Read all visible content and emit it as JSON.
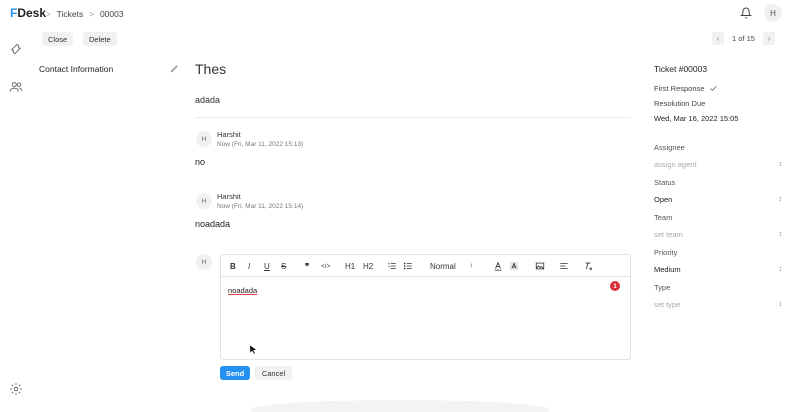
{
  "app": {
    "logo_letter": "F",
    "logo_rest": "Desk"
  },
  "breadcrumb": [
    "Tickets",
    "00003"
  ],
  "user": {
    "initial": "H"
  },
  "toolbar": {
    "close_label": "Close",
    "delete_label": "Delete",
    "pager_text": "1 of 15"
  },
  "contact": {
    "title": "Contact Information"
  },
  "ticket": {
    "subject": "Thes",
    "description": "adada",
    "messages": [
      {
        "initial": "H",
        "name": "Harshit",
        "time": "Now (Fri, Mar 11, 2022 15:13)",
        "body": "no"
      },
      {
        "initial": "H",
        "name": "Harshit",
        "time": "Now (Fri, Mar 11, 2022 15:14)",
        "body": "noadada"
      }
    ]
  },
  "editor": {
    "avatar_initial": "H",
    "toolbar": {
      "bold": "B",
      "italic": "I",
      "underline": "U",
      "strike": "S",
      "quote": "❞",
      "code": "</>",
      "h1": "H1",
      "h2": "H2",
      "text_style": "Normal"
    },
    "text": "noadada",
    "error_count": "1",
    "send_label": "Send",
    "cancel_label": "Cancel"
  },
  "details": {
    "title": "Ticket #00003",
    "first_response": "First Response",
    "resolution_due_label": "Resolution Due",
    "resolution_due_value": "Wed, Mar 16, 2022 15:05",
    "assignee_label": "Assignee",
    "assignee_placeholder": "assign agent",
    "status_label": "Status",
    "status_value": "Open",
    "team_label": "Team",
    "team_placeholder": "set team",
    "priority_label": "Priority",
    "priority_value": "Medium",
    "type_label": "Type",
    "type_placeholder": "set type"
  },
  "colors": {
    "accent": "#2490ef",
    "error": "#d9303a"
  }
}
